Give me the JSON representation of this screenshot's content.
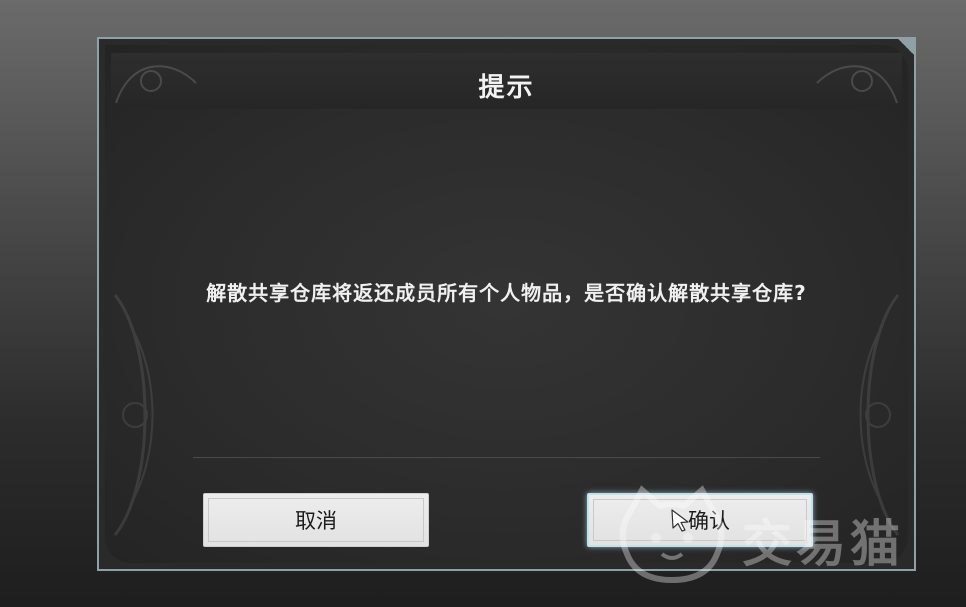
{
  "dialog": {
    "title": "提示",
    "message": "解散共享仓库将返还成员所有个人物品，是否确认解散共享仓库?",
    "cancel_label": "取消",
    "confirm_label": "确认"
  },
  "watermark": {
    "text": "交易猫",
    "icon": "cat-logo-icon"
  },
  "colors": {
    "frame_border": "#8fa0a6",
    "dialog_bg": "#2c2c2c",
    "button_bg": "#e6e6e6",
    "confirm_glow": "#bfe3ec",
    "text_light": "#f0f0f0",
    "text_dark": "#1c1c1c"
  }
}
